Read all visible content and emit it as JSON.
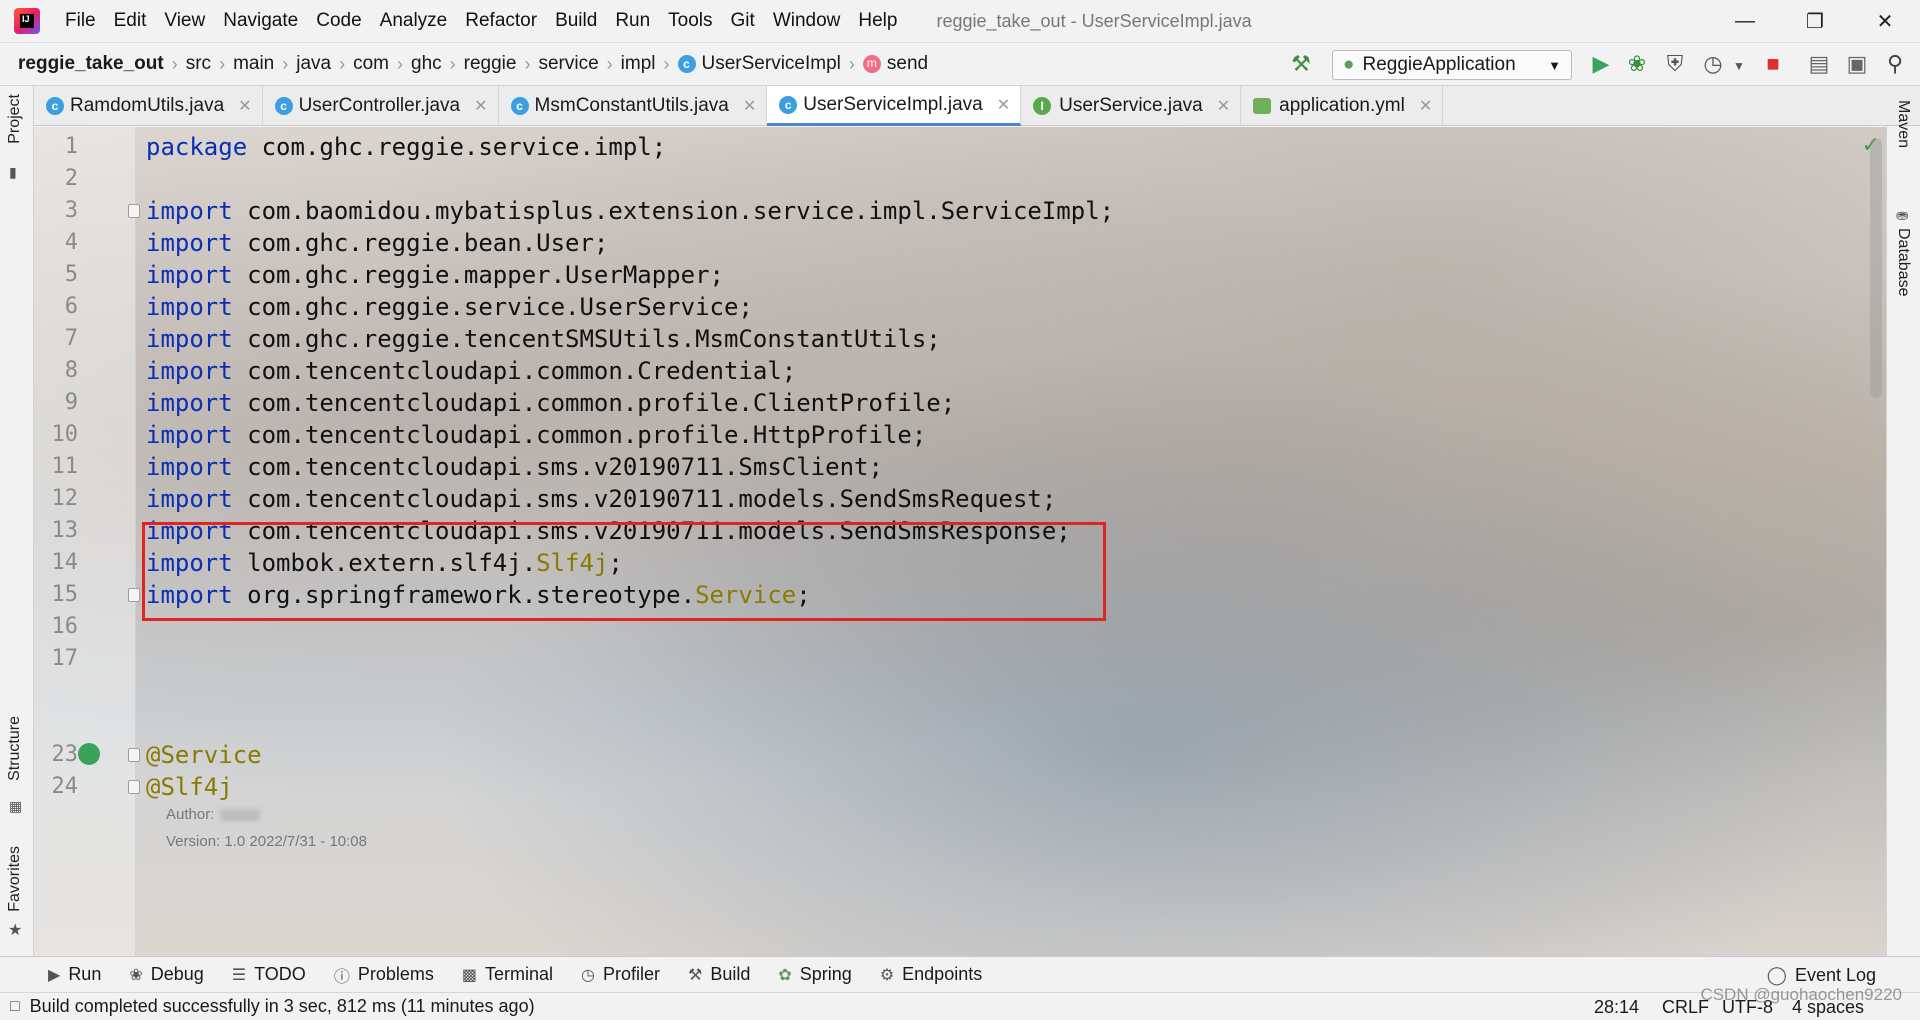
{
  "menubar": {
    "items": [
      "File",
      "Edit",
      "View",
      "Navigate",
      "Code",
      "Analyze",
      "Refactor",
      "Build",
      "Run",
      "Tools",
      "Git",
      "Window",
      "Help"
    ],
    "window_title": "reggie_take_out - UserServiceImpl.java"
  },
  "breadcrumb": {
    "project": "reggie_take_out",
    "parts": [
      "src",
      "main",
      "java",
      "com",
      "ghc",
      "reggie",
      "service",
      "impl"
    ],
    "class_name": "UserServiceImpl",
    "method_name": "send"
  },
  "run_config": {
    "label": "ReggieApplication"
  },
  "tabs": [
    {
      "label": "RamdomUtils.java",
      "icon": "class-icon",
      "active": false
    },
    {
      "label": "UserController.java",
      "icon": "class-icon",
      "active": false
    },
    {
      "label": "MsmConstantUtils.java",
      "icon": "class-icon",
      "active": false
    },
    {
      "label": "UserServiceImpl.java",
      "icon": "class-icon",
      "active": true
    },
    {
      "label": "UserService.java",
      "icon": "interface-icon",
      "active": false
    },
    {
      "label": "application.yml",
      "icon": "yaml-icon",
      "active": false
    }
  ],
  "side_tools": {
    "left": [
      "Project",
      "Structure",
      "Favorites"
    ],
    "right": [
      "Maven",
      "Database"
    ]
  },
  "code_lines": [
    {
      "n": "1",
      "kw": "package",
      "text": " com.ghc.reggie.service.impl;",
      "suffix": ""
    },
    {
      "n": "2",
      "kw": "",
      "text": "",
      "suffix": ""
    },
    {
      "n": "3",
      "kw": "import",
      "text": " com.baomidou.mybatisplus.extension.service.impl.ServiceImpl;",
      "suffix": ""
    },
    {
      "n": "4",
      "kw": "import",
      "text": " com.ghc.reggie.bean.User;",
      "suffix": ""
    },
    {
      "n": "5",
      "kw": "import",
      "text": " com.ghc.reggie.mapper.UserMapper;",
      "suffix": ""
    },
    {
      "n": "6",
      "kw": "import",
      "text": " com.ghc.reggie.service.UserService;",
      "suffix": ""
    },
    {
      "n": "7",
      "kw": "import",
      "text": " com.ghc.reggie.tencentSMSUtils.MsmConstantUtils;",
      "suffix": ""
    },
    {
      "n": "8",
      "kw": "import",
      "text": " com.tencentcloudapi.common.Credential;",
      "suffix": ""
    },
    {
      "n": "9",
      "kw": "import",
      "text": " com.tencentcloudapi.common.profile.ClientProfile;",
      "suffix": ""
    },
    {
      "n": "10",
      "kw": "import",
      "text": " com.tencentcloudapi.common.profile.HttpProfile;",
      "suffix": ""
    },
    {
      "n": "11",
      "kw": "import",
      "text": " com.tencentcloudapi.sms.v20190711.SmsClient;",
      "suffix": ""
    },
    {
      "n": "12",
      "kw": "import",
      "text": " com.tencentcloudapi.sms.v20190711.models.SendSmsRequest;",
      "suffix": ""
    },
    {
      "n": "13",
      "kw": "import",
      "text": " com.tencentcloudapi.sms.v20190711.models.SendSmsResponse;",
      "suffix": ""
    },
    {
      "n": "14",
      "kw": "import",
      "text": " lombok.extern.slf4j.",
      "ann": "Slf4j",
      "suffix": ";"
    },
    {
      "n": "15",
      "kw": "import",
      "text": " org.springframework.stereotype.",
      "ann": "Service",
      "suffix": ";"
    },
    {
      "n": "16",
      "kw": "",
      "text": "",
      "suffix": ""
    },
    {
      "n": "17",
      "kw": "",
      "text": "",
      "suffix": ""
    }
  ],
  "doc_comment": {
    "author_label": "Author:",
    "version_label": "Version:",
    "version_value": "1.0 2022/7/31 - 10:08"
  },
  "annotation_lines": [
    {
      "n": "23",
      "text": "@Service"
    },
    {
      "n": "24",
      "text": "@Slf4j"
    }
  ],
  "bottom_tools": [
    "Run",
    "Debug",
    "TODO",
    "Problems",
    "Terminal",
    "Profiler",
    "Build",
    "Spring",
    "Endpoints"
  ],
  "event_log": "Event Log",
  "status": {
    "message": "Build completed successfully in 3 sec, 812 ms (11 minutes ago)",
    "position": "28:14",
    "line_sep": "CRLF",
    "encoding": "UTF-8",
    "indent": "4 spaces"
  },
  "watermark": "CSDN @guohaochen9220",
  "colors": {
    "keyword": "#0a2fb3",
    "annotation": "#8a7a00",
    "highlight_box": "#e02424",
    "active_tab_underline": "#4a88c7"
  }
}
